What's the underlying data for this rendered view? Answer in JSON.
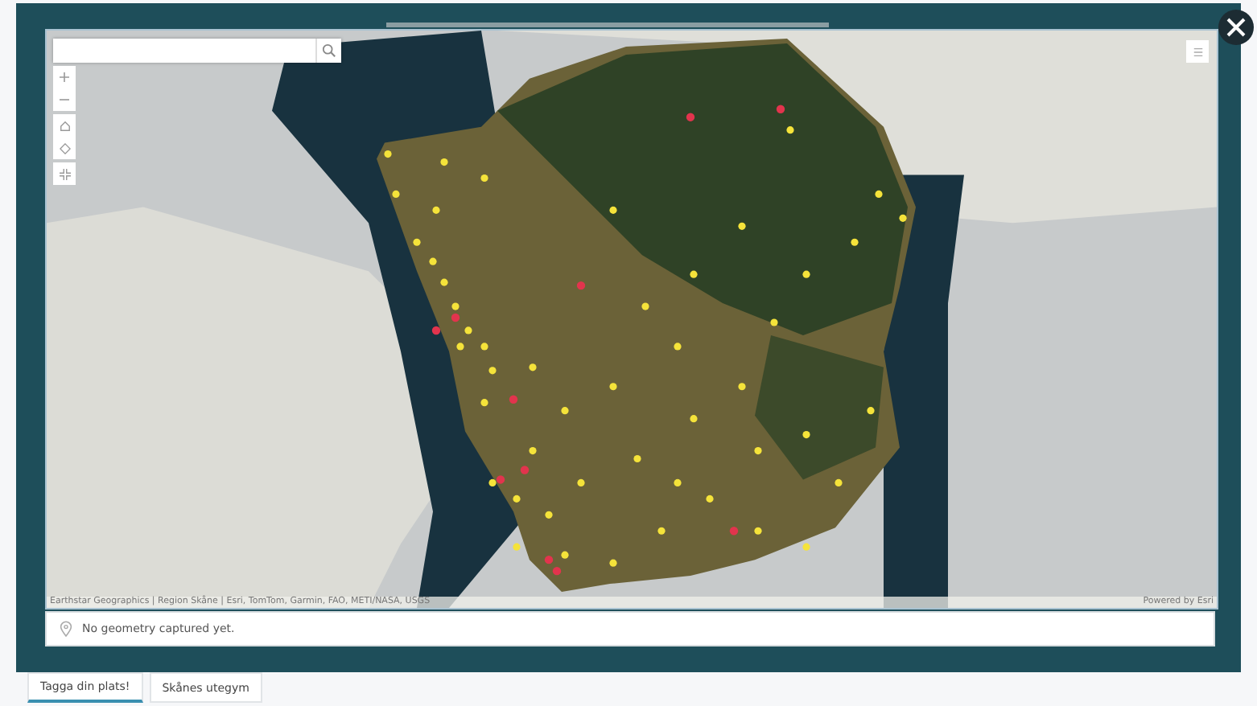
{
  "map": {
    "attribution": "Earthstar Geographics | Region Skåne | Esri, TomTom, Garmin, FAO, METI/NASA, USGS",
    "powered_by": "Powered by Esri"
  },
  "geometry_status": "No geometry captured yet.",
  "tabs": [
    {
      "label": "Tagga din plats!",
      "selected": true
    },
    {
      "label": "Skånes utegym",
      "selected": false
    }
  ]
}
